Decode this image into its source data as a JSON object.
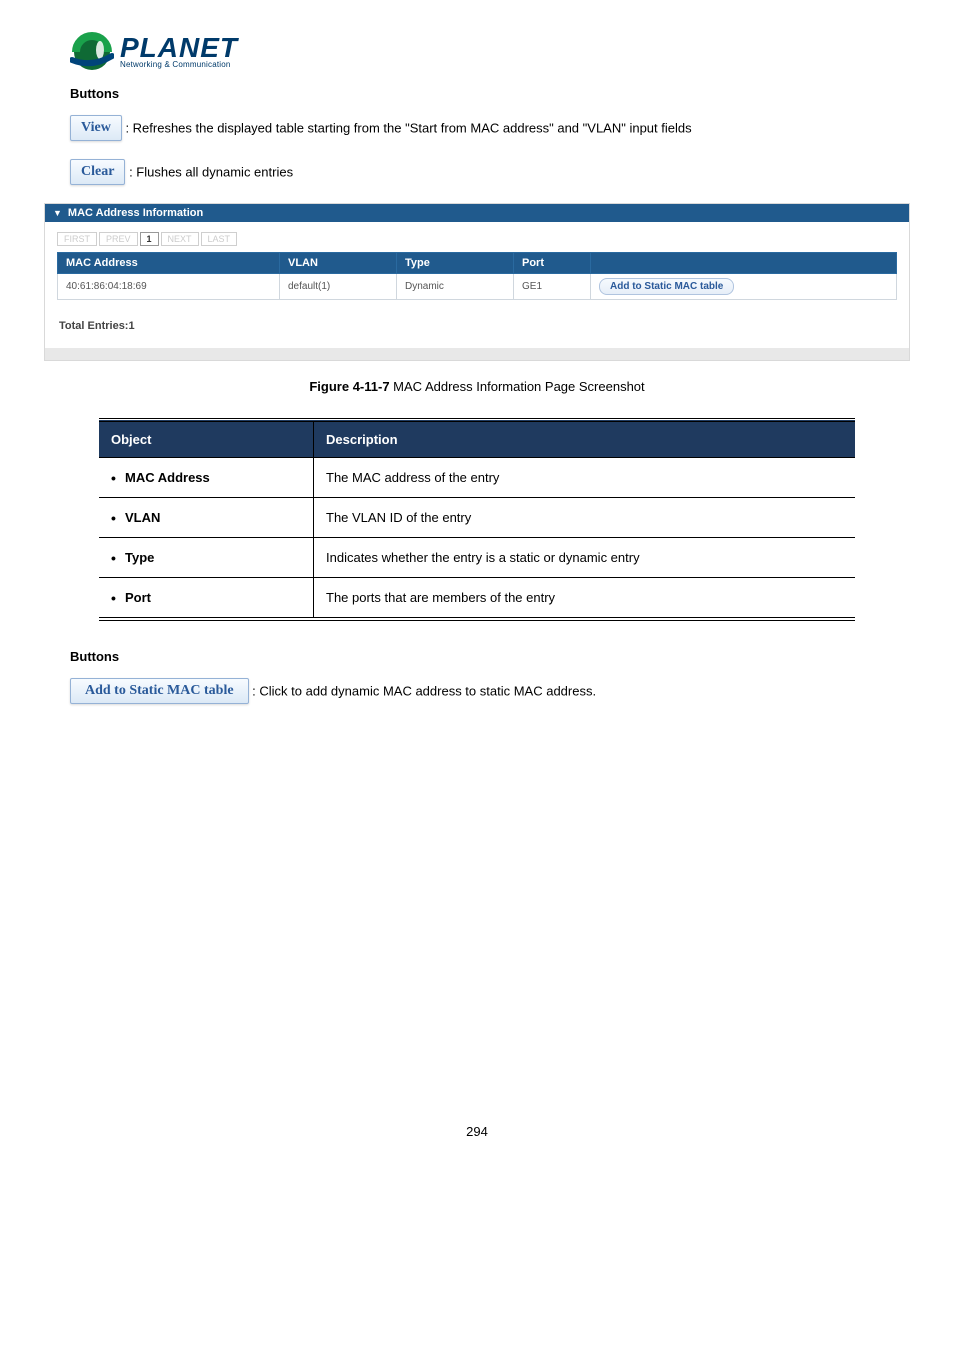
{
  "logo": {
    "brand": "PLANET",
    "tagline": "Networking & Communication"
  },
  "buttons_sections": [
    {
      "heading": "Buttons",
      "items": [
        {
          "button_text": "View",
          "desc": ": Refreshes the displayed table starting from the \"Start from MAC address\" and \"VLAN\" input fields"
        },
        {
          "button_text": "Clear",
          "desc": ": Flushes all dynamic entries"
        }
      ]
    },
    {
      "heading": "Buttons",
      "items": [
        {
          "button_text": "Add to Static MAC table",
          "desc": ": Click to add dynamic MAC address to static MAC address."
        }
      ]
    }
  ],
  "panel": {
    "title": "MAC Address Information",
    "pager": {
      "first": "FIRST",
      "prev": "PREV",
      "current": "1",
      "next": "NEXT",
      "last": "LAST"
    },
    "columns": {
      "mac": "MAC Address",
      "vlan": "VLAN",
      "type": "Type",
      "port": "Port",
      "action": ""
    },
    "rows": [
      {
        "mac": "40:61:86:04:18:69",
        "vlan": "default(1)",
        "type": "Dynamic",
        "port": "GE1",
        "action": "Add to Static MAC table"
      }
    ],
    "total_entries_label": "Total Entries:1"
  },
  "figure_caption": {
    "bold": "Figure 4-11-7",
    "rest": " MAC Address Information Page Screenshot"
  },
  "desc_table": {
    "headers": {
      "object": "Object",
      "description": "Description"
    },
    "rows": [
      {
        "object": "MAC Address",
        "description": "The MAC address of the entry"
      },
      {
        "object": "VLAN",
        "description": "The VLAN ID of the entry"
      },
      {
        "object": "Type",
        "description": "Indicates whether the entry is a static or dynamic entry"
      },
      {
        "object": "Port",
        "description": "The ports that are members of the entry"
      }
    ]
  },
  "page_number": "294"
}
